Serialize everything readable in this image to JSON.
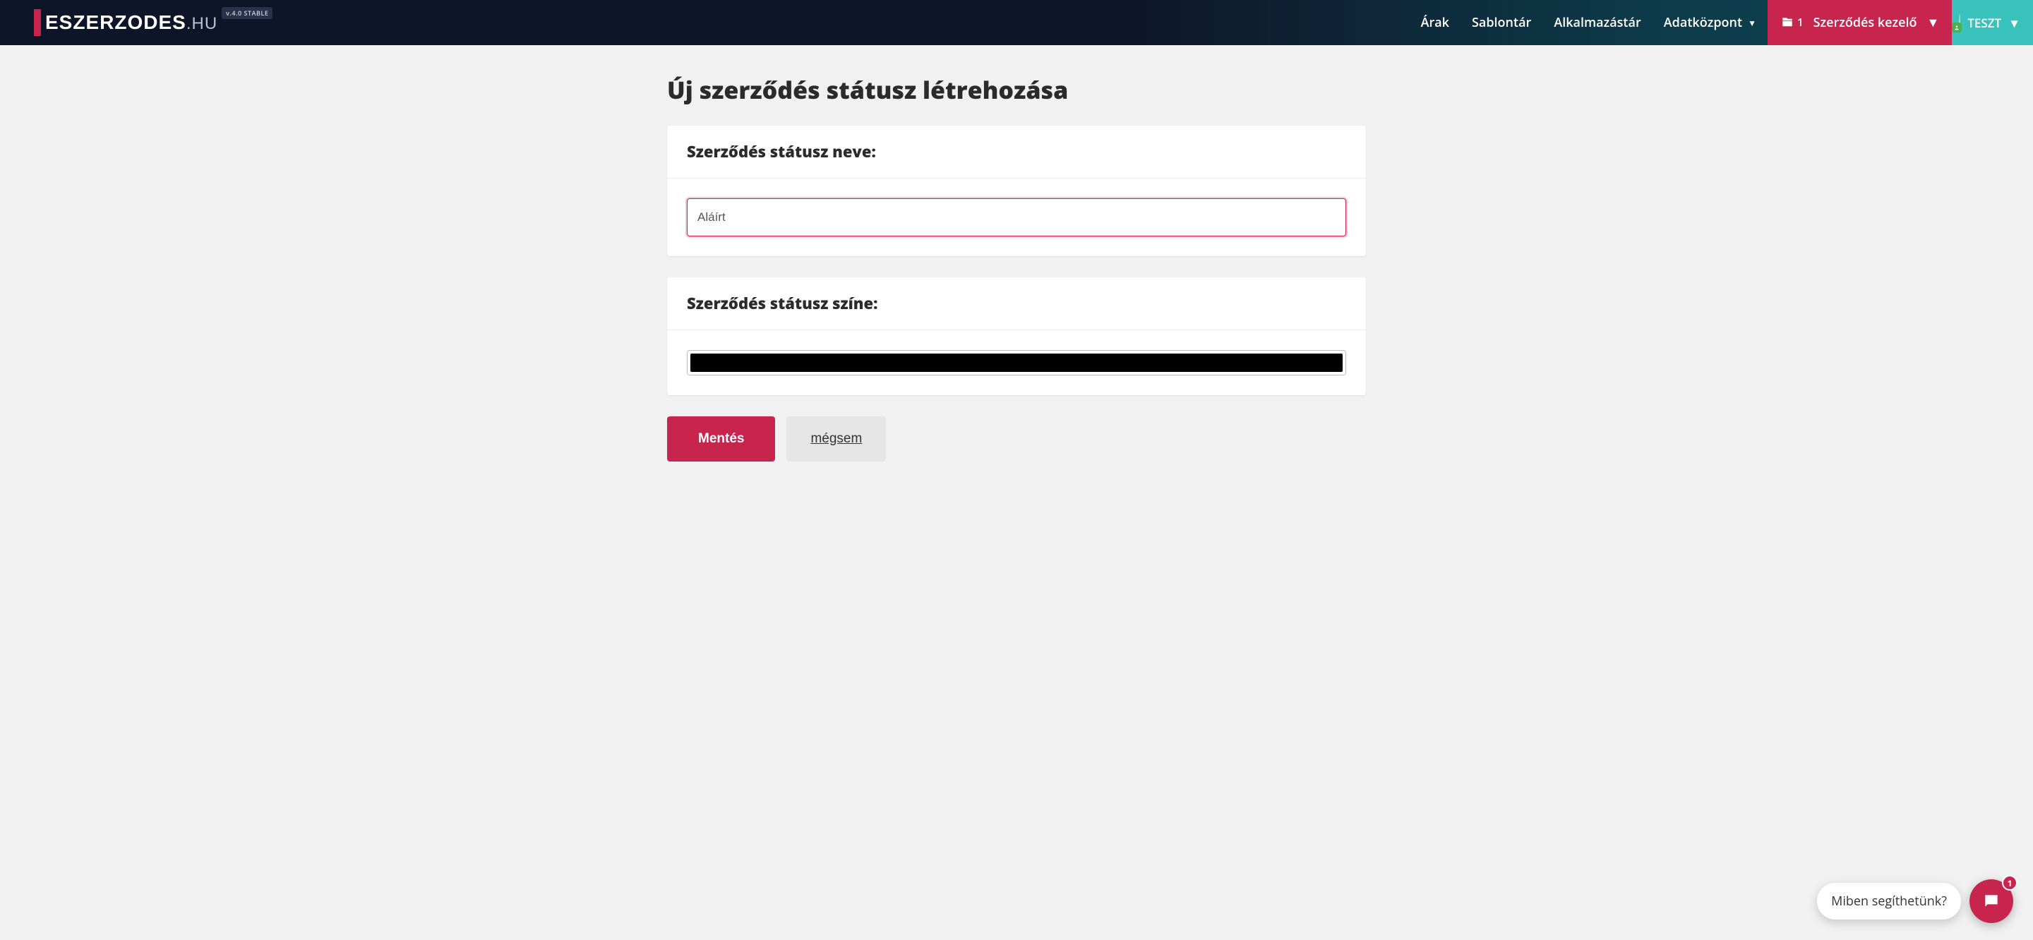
{
  "brand": {
    "name_main": "ESZERZODES",
    "name_suffix": ".HU",
    "version": "v.4.0 STABLE"
  },
  "nav": {
    "items": [
      "Árak",
      "Sablontár",
      "Alkalmazástár",
      "Adatközpont"
    ],
    "contract_manager": {
      "label": "Szerződés kezelő",
      "doc_count": "1"
    },
    "user": {
      "name": "TESZT"
    }
  },
  "page": {
    "title": "Új szerződés státusz létrehozása",
    "sections": {
      "name": {
        "heading": "Szerződés státusz neve:",
        "value": "Aláírt"
      },
      "color": {
        "heading": "Szerződés státusz színe:",
        "value": "#000000"
      }
    },
    "actions": {
      "save": "Mentés",
      "cancel": "mégsem"
    }
  },
  "chat": {
    "prompt": "Miben segíthetünk?",
    "unread": "1"
  }
}
